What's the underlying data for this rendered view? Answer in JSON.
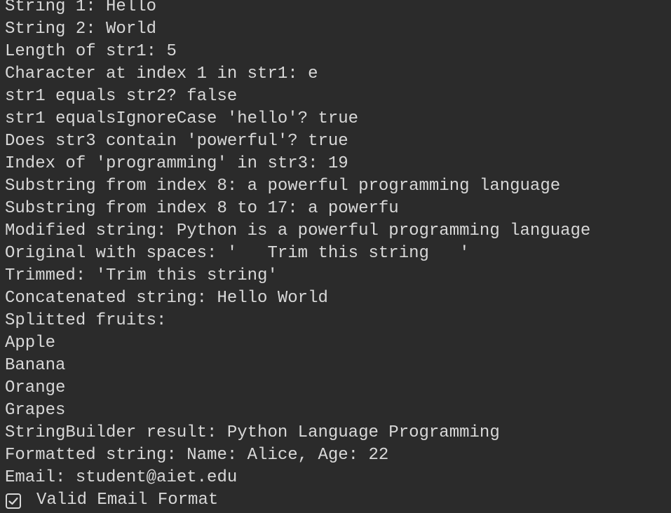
{
  "console": {
    "lines": [
      "String 1: Hello",
      "String 2: World",
      "Length of str1: 5",
      "Character at index 1 in str1: e",
      "str1 equals str2? false",
      "str1 equalsIgnoreCase 'hello'? true",
      "Does str3 contain 'powerful'? true",
      "Index of 'programming' in str3: 19",
      "Substring from index 8: a powerful programming language",
      "Substring from index 8 to 17: a powerfu",
      "Modified string: Python is a powerful programming language",
      "Original with spaces: '   Trim this string   '",
      "Trimmed: 'Trim this string'",
      "Concatenated string: Hello World",
      "Splitted fruits:",
      "Apple",
      "Banana",
      "Orange",
      "Grapes",
      "StringBuilder result: Python Language Programming",
      "Formatted string: Name: Alice, Age: 22",
      "Email: student@aiet.edu"
    ],
    "final_line_text": "Valid Email Format",
    "final_line_icon": "checkbox-checked-icon"
  },
  "colors": {
    "background": "#2b2b2b",
    "text": "#d8d8d8"
  }
}
